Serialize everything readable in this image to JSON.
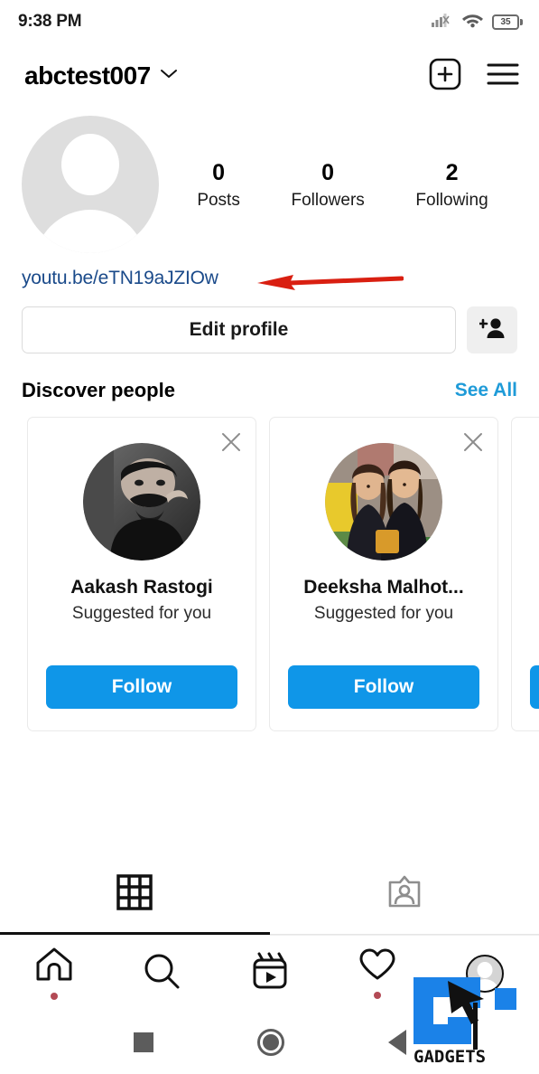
{
  "status_bar": {
    "time": "9:38 PM",
    "signal_icon": "signal-bars-no-sim-icon",
    "wifi_icon": "wifi-icon",
    "battery_level": "35",
    "battery_icon": "battery-icon"
  },
  "header": {
    "username": "abctest007",
    "chevron_icon": "chevron-down-icon",
    "add_icon": "plus-square-icon",
    "menu_icon": "hamburger-menu-icon"
  },
  "profile": {
    "avatar_icon": "default-avatar-icon",
    "stats": [
      {
        "value": "0",
        "label": "Posts"
      },
      {
        "value": "0",
        "label": "Followers"
      },
      {
        "value": "2",
        "label": "Following"
      }
    ],
    "bio_link": "youtu.be/eTN19aJZIOw",
    "edit_profile_label": "Edit profile",
    "add_person_icon": "add-person-icon"
  },
  "discover": {
    "title": "Discover people",
    "see_all_label": "See All",
    "close_icon": "close-x-icon",
    "cards": [
      {
        "name": "Aakash Rastogi",
        "subtitle": "Suggested for you",
        "follow_label": "Follow"
      },
      {
        "name": "Deeksha Malhot...",
        "subtitle": "Suggested for you",
        "follow_label": "Follow"
      },
      {
        "name": "",
        "subtitle": "",
        "follow_label": ""
      }
    ]
  },
  "profile_tabs": [
    {
      "icon": "grid-icon",
      "active": true
    },
    {
      "icon": "tagged-person-icon",
      "active": false
    }
  ],
  "bottom_nav": [
    {
      "icon": "home-icon",
      "badge": true
    },
    {
      "icon": "search-icon",
      "badge": false
    },
    {
      "icon": "reels-icon",
      "badge": false
    },
    {
      "icon": "heart-icon",
      "badge": true
    },
    {
      "icon": "profile-avatar-icon",
      "badge": false
    }
  ],
  "android_nav": [
    {
      "icon": "recents-square-icon"
    },
    {
      "icon": "home-circle-icon"
    },
    {
      "icon": "back-triangle-icon"
    }
  ],
  "annotation": {
    "arrow_icon": "red-arrow-left-icon",
    "arrow_color": "#d91f11"
  },
  "watermark": {
    "text": "GADGETS",
    "brand_color": "#1b82e8"
  },
  "colors": {
    "follow_blue": "#0f96e8",
    "see_all_blue": "#1f9bd8",
    "link_blue": "#1a4a8a",
    "badge_red": "#b34a55"
  }
}
